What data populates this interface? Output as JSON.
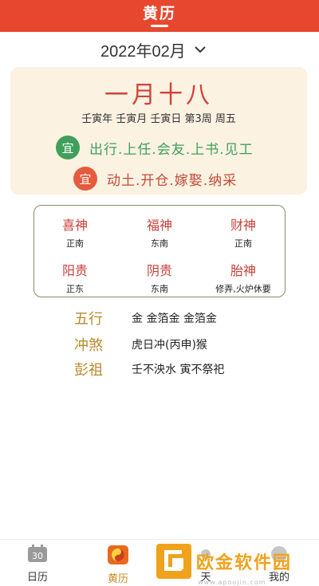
{
  "header": {
    "title": "黄历"
  },
  "month_selector": {
    "label": "2022年02月"
  },
  "lunar": {
    "date": "一月十八",
    "ganzhi": "壬寅年 壬寅月 壬寅日 第3周 周五"
  },
  "yi": {
    "badge": "宜",
    "text": "出行.上任.会友.上书.见工"
  },
  "ji": {
    "badge": "宜",
    "text": "动土.开仓.嫁娶.纳采"
  },
  "gods": [
    {
      "name": "喜神",
      "direction": "正南"
    },
    {
      "name": "福神",
      "direction": "东南"
    },
    {
      "name": "财神",
      "direction": "正南"
    },
    {
      "name": "阳贵",
      "direction": "正东"
    },
    {
      "name": "阴贵",
      "direction": "东南"
    },
    {
      "name": "胎神",
      "direction": "修弄,火炉休要"
    }
  ],
  "info": [
    {
      "label": "五行",
      "value": "金 金箔金 金箔金"
    },
    {
      "label": "冲煞",
      "value": "虎日冲(丙申)猴"
    },
    {
      "label": "彭祖",
      "value": "壬不泱水 寅不祭祀"
    }
  ],
  "nav": [
    {
      "label": "日历",
      "icon": "calendar-icon",
      "active": false
    },
    {
      "label": "黄历",
      "icon": "taiji-icon",
      "active": true
    },
    {
      "label": "天",
      "icon": "weather-icon",
      "active": false
    },
    {
      "label": "我的",
      "icon": "profile-icon",
      "active": false
    }
  ],
  "calendar_icon_text": "30",
  "watermark": {
    "text": "欧金软件园",
    "url": "www.apoujin.com"
  },
  "colors": {
    "header": "#e8472f",
    "lunar_red": "#d3413b",
    "yi_green": "#3f9f5b",
    "ji_red": "#e65a3d",
    "gold": "#b88b2c",
    "card_bg": "#fbf2e2"
  }
}
